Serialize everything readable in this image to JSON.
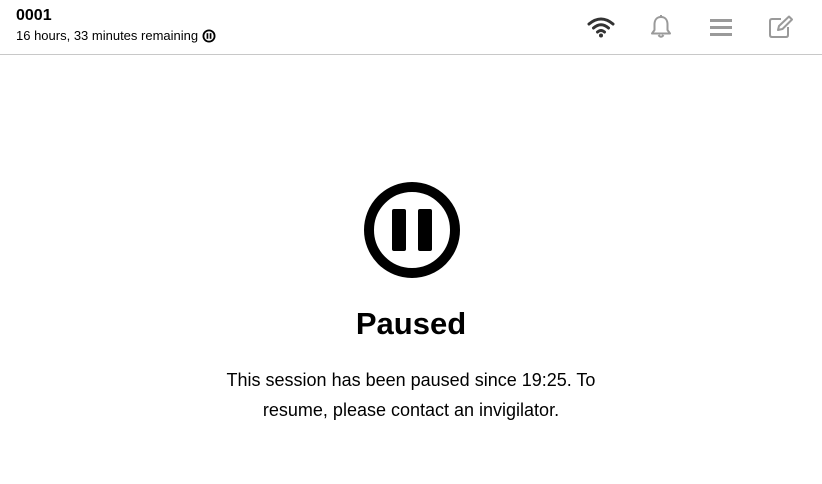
{
  "header": {
    "session_id": "0001",
    "time_remaining": "16 hours, 33 minutes remaining",
    "icons": [
      "wifi-icon",
      "bell-icon",
      "menu-icon",
      "edit-icon"
    ],
    "icon_colors": {
      "wifi": "#333333",
      "others": "#9a9a9a"
    }
  },
  "main": {
    "status_icon": "pause-circle-icon",
    "heading": "Paused",
    "message": "This session has been paused since 19:25. To resume, please contact an invigilator."
  }
}
